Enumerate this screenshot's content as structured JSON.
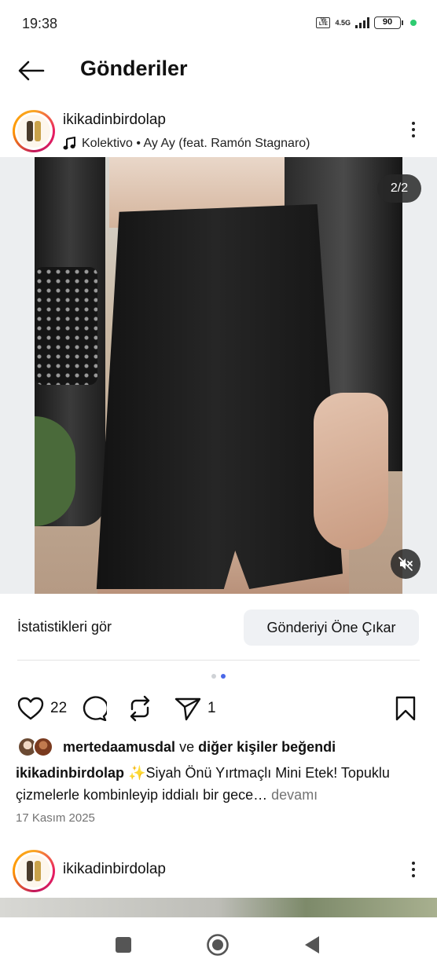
{
  "status_bar": {
    "time": "19:38",
    "volte": "Vo LTE",
    "network": "4.5G",
    "battery": "90"
  },
  "header": {
    "title": "Gönderiler"
  },
  "post": {
    "username": "ikikadinbirdolap",
    "music": "Kolektivo • Ay Ay (feat. Ramón Stagnaro)",
    "media_counter": "2/2",
    "insights_label": "İstatistikleri gör",
    "boost_label": "Gönderiyi Öne Çıkar",
    "carousel": {
      "count": 2,
      "active": 2
    },
    "likes": "22",
    "shares": "1",
    "liked_by_user": "mertedaamusdal",
    "liked_by_joiner": "ve",
    "liked_by_others": "diğer kişiler beğendi",
    "caption_user": "ikikadinbirdolap",
    "caption_text": "✨Siyah Önü Yırtmaçlı Mini Etek! Topuklu çizmelerle kombinleyip iddialı bir gece…",
    "caption_more": "devamı",
    "date": "17 Kasım 2025"
  },
  "next_post": {
    "username": "ikikadinbirdolap"
  },
  "icons": {
    "back": "arrow-left-icon",
    "more": "more-vertical-icon",
    "music": "music-note-icon",
    "like": "heart-icon",
    "comment": "comment-icon",
    "repost": "repost-icon",
    "share": "send-icon",
    "save": "bookmark-icon",
    "mute": "speaker-muted-icon"
  },
  "colors": {
    "accent": "#4a67e8",
    "muted_text": "#737373",
    "button_bg": "#eff1f4",
    "status_dot": "#2ecc71"
  }
}
